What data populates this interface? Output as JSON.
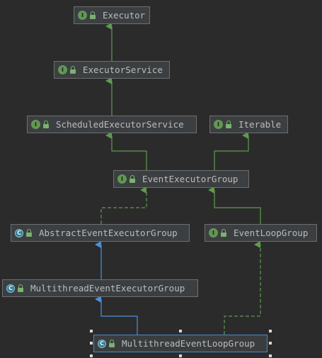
{
  "nodes": [
    {
      "label": "Executor",
      "kind": "interface",
      "badge": "I"
    },
    {
      "label": "ExecutorService",
      "kind": "interface",
      "badge": "I"
    },
    {
      "label": "ScheduledExecutorService",
      "kind": "interface",
      "badge": "I"
    },
    {
      "label": "Iterable",
      "kind": "interface",
      "badge": "I"
    },
    {
      "label": "EventExecutorGroup",
      "kind": "interface",
      "badge": "I"
    },
    {
      "label": "AbstractEventExecutorGroup",
      "kind": "abstract-class",
      "badge": "C"
    },
    {
      "label": "EventLoopGroup",
      "kind": "interface",
      "badge": "I"
    },
    {
      "label": "MultithreadEventExecutorGroup",
      "kind": "abstract-class",
      "badge": "C"
    },
    {
      "label": "MultithreadEventLoopGroup",
      "kind": "abstract-class",
      "badge": "C"
    }
  ],
  "edges": [
    {
      "from": "ExecutorService",
      "to": "Executor",
      "relation": "extends"
    },
    {
      "from": "ScheduledExecutorService",
      "to": "ExecutorService",
      "relation": "extends"
    },
    {
      "from": "EventExecutorGroup",
      "to": "ScheduledExecutorService",
      "relation": "extends"
    },
    {
      "from": "EventExecutorGroup",
      "to": "Iterable",
      "relation": "extends"
    },
    {
      "from": "AbstractEventExecutorGroup",
      "to": "EventExecutorGroup",
      "relation": "implements"
    },
    {
      "from": "EventLoopGroup",
      "to": "EventExecutorGroup",
      "relation": "extends"
    },
    {
      "from": "MultithreadEventExecutorGroup",
      "to": "AbstractEventExecutorGroup",
      "relation": "extends"
    },
    {
      "from": "MultithreadEventLoopGroup",
      "to": "MultithreadEventExecutorGroup",
      "relation": "extends"
    },
    {
      "from": "MultithreadEventLoopGroup",
      "to": "EventLoopGroup",
      "relation": "implements"
    }
  ],
  "selected": "MultithreadEventLoopGroup",
  "colors": {
    "background": "#2b2b2b",
    "node_fill": "#3c3f41",
    "node_border": "#6e6e6e",
    "selected_border": "#4a88c7",
    "interface_edge": "#5f9a4f",
    "class_edge": "#4a90d9",
    "interface_badge": "#629755",
    "class_badge": "#3d7a8f"
  }
}
